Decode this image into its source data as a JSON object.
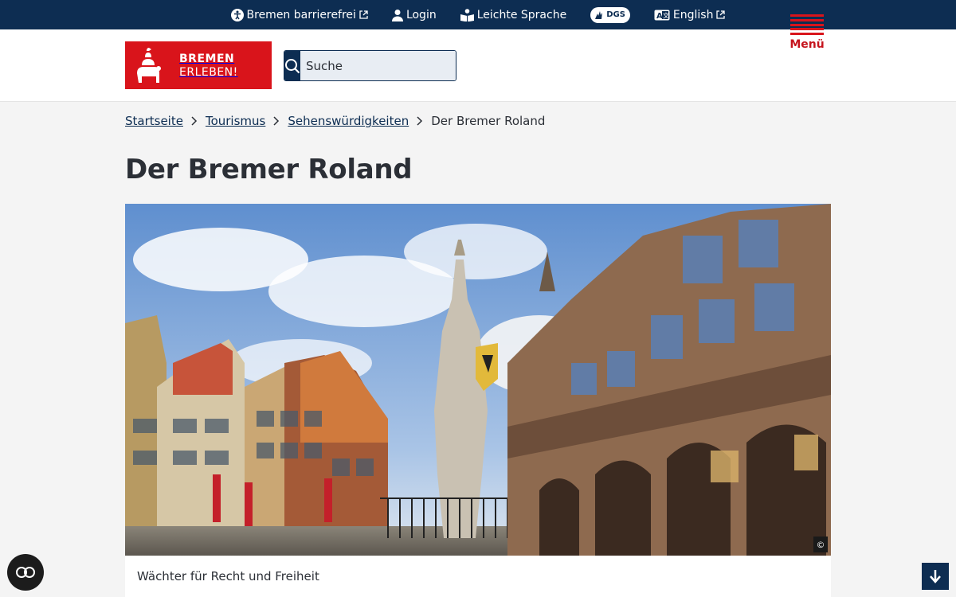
{
  "topbar": {
    "items": [
      {
        "label": "Bremen barrierefrei",
        "icon": "accessibility-icon",
        "external": true
      },
      {
        "label": "Login",
        "icon": "user-icon",
        "external": false
      },
      {
        "label": "Leichte Sprache",
        "icon": "easy-language-icon",
        "external": false
      },
      {
        "label": "DGS",
        "icon": "sign-language-icon",
        "external": false
      },
      {
        "label": "English",
        "icon": "translate-icon",
        "external": true
      }
    ]
  },
  "header": {
    "logo_line1": "BREMEN",
    "logo_line2": "ERLEBEN!",
    "search_placeholder": "Suche",
    "menu_label": "Menü"
  },
  "breadcrumb": {
    "items": [
      "Startseite",
      "Tourismus",
      "Sehenswürdigkeiten"
    ],
    "current": "Der Bremer Roland"
  },
  "page": {
    "title": "Der Bremer Roland",
    "copyright_symbol": "©",
    "caption": "Wächter für Recht und Freiheit"
  },
  "floating": {
    "a11y_label": "CO"
  },
  "colors": {
    "navy": "#0d2d52",
    "brand_red": "#d9141b",
    "page_bg": "#f4f4f4"
  }
}
